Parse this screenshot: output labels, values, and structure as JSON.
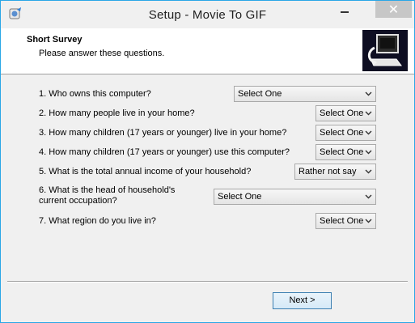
{
  "window": {
    "title": "Setup - Movie To GIF"
  },
  "header": {
    "title": "Short Survey",
    "subtitle": "Please answer these questions."
  },
  "questions": [
    {
      "label": "1. Who owns this computer?",
      "value": "Select One"
    },
    {
      "label": "2. How many people live in your home?",
      "value": "Select One"
    },
    {
      "label": "3. How many children (17 years or younger) live in your home?",
      "value": "Select One"
    },
    {
      "label": "4. How many children (17 years or younger) use this computer?",
      "value": "Select One"
    },
    {
      "label": "5. What is the total annual income of your household?",
      "value": "Rather not say"
    },
    {
      "label_line1": "6. What is the head of household's",
      "label_line2": "current occupation?",
      "value": "Select One"
    },
    {
      "label": "7. What region do you live in?",
      "value": "Select One"
    }
  ],
  "footer": {
    "next_label": "Next >"
  },
  "icons": {
    "app": "setup-app-icon",
    "logo": "computer-install-icon",
    "chevron": "chevron-down-icon"
  }
}
